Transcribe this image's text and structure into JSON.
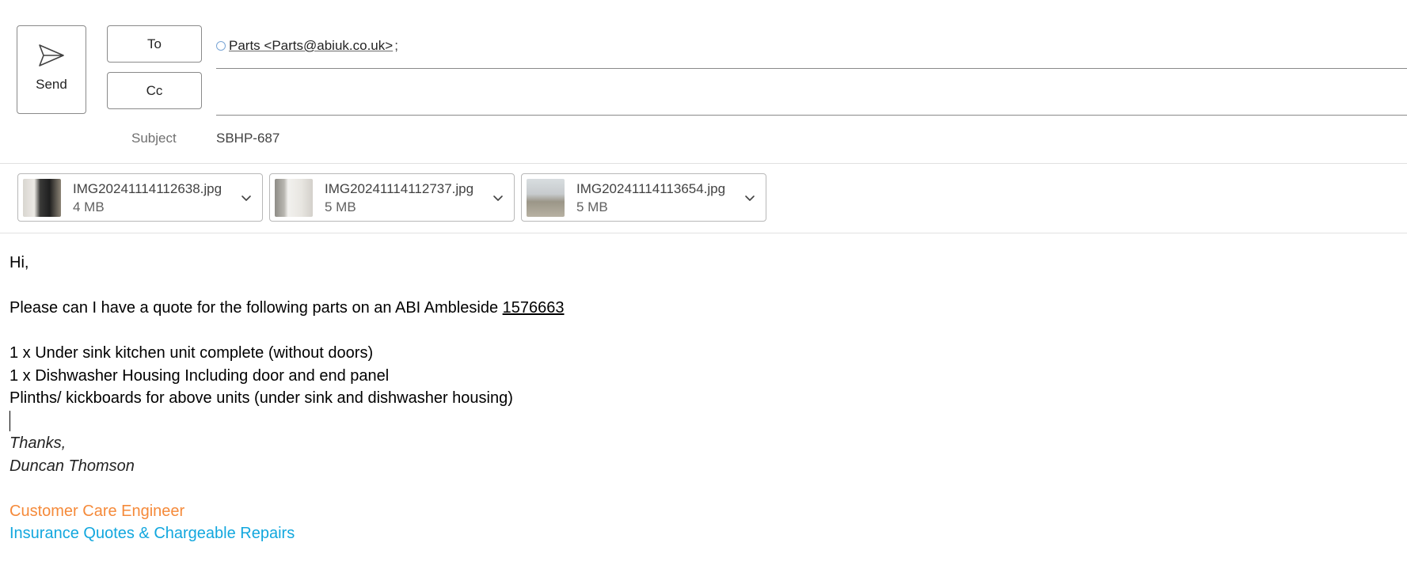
{
  "toolbar": {
    "send_label": "Send",
    "send_icon": "send-icon"
  },
  "recipients": {
    "to_label": "To",
    "cc_label": "Cc",
    "to": [
      {
        "display": "Parts <Parts@abiuk.co.uk>",
        "separator": ";"
      }
    ],
    "cc": []
  },
  "subject": {
    "label": "Subject",
    "value": "SBHP-687"
  },
  "attachments": [
    {
      "name": "IMG20241114112638.jpg",
      "size": "4 MB"
    },
    {
      "name": "IMG20241114112737.jpg",
      "size": "5 MB"
    },
    {
      "name": "IMG20241114113654.jpg",
      "size": "5 MB"
    }
  ],
  "body": {
    "greeting": "Hi,",
    "request_prefix": "Please can I have a quote for the following parts on an ABI Ambleside ",
    "request_ref": "1576663",
    "items": [
      "1 x Under sink kitchen unit complete (without doors)",
      "1 x Dishwasher Housing Including door and end panel",
      "Plinths/ kickboards for above units (under sink and dishwasher housing)"
    ],
    "signoff": "Thanks,",
    "sender_name": "Duncan Thomson",
    "sender_title": "Customer Care Engineer",
    "sender_department": "Insurance Quotes & Chargeable Repairs"
  },
  "colors": {
    "title_orange": "#f58a3a",
    "department_cyan": "#12a7de",
    "border": "#8a8a8a"
  }
}
